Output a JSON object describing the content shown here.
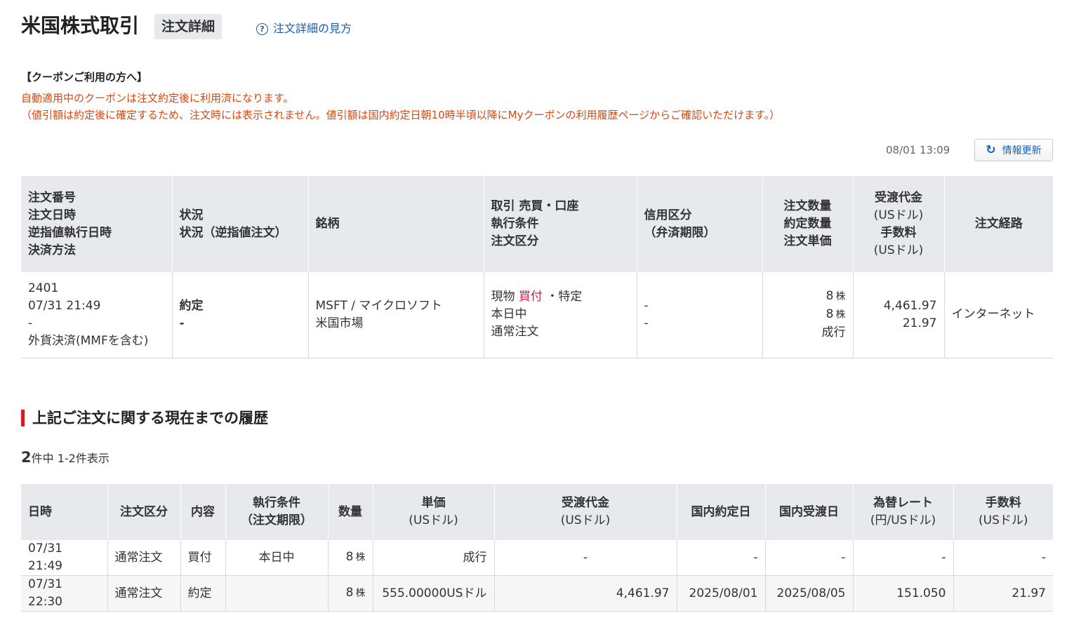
{
  "header": {
    "title": "米国株式取引",
    "badge": "注文詳細",
    "help_icon": "question-circle-icon",
    "help_link": "注文詳細の見方"
  },
  "coupon": {
    "heading": "【クーポンご利用の方へ】",
    "line1": "自動適用中のクーポンは注文約定後に利用済になります。",
    "line2": "（値引額は約定後に確定するため、注文時には表示されません。値引額は国内約定日朝10時半頃以降にMyクーポンの利用履歴ページからご確認いただけます。）"
  },
  "refresh": {
    "timestamp": "08/01 13:09",
    "icon": "refresh-icon",
    "label": "情報更新"
  },
  "order_table": {
    "headers": {
      "c1": [
        "注文番号",
        "注文日時",
        "逆指値執行日時",
        "決済方法"
      ],
      "c2": [
        "状況",
        "状況（逆指値注文）"
      ],
      "c3": [
        "銘柄"
      ],
      "c4": [
        "取引 売買・口座",
        "執行条件",
        "注文区分"
      ],
      "c5": [
        "信用区分",
        "（弁済期限）"
      ],
      "c6": [
        "注文数量",
        "約定数量",
        "注文単価"
      ],
      "c7": {
        "top": "受渡代金",
        "top_sub": "(USドル)",
        "bottom": "手数料",
        "bottom_sub": "(USドル)"
      },
      "c8": "注文経路"
    },
    "row": {
      "order_no": "2401",
      "order_datetime": "07/31 21:49",
      "stop_datetime": "-",
      "settlement": "外貨決済(MMFを含む)",
      "status": "約定",
      "status_stop": "-",
      "symbol": "MSFT / マイクロソフト",
      "market": "米国市場",
      "trade_type": "現物",
      "side": "買付",
      "account": "・特定",
      "condition": "本日中",
      "order_type": "通常注文",
      "margin": "-",
      "margin_due": "-",
      "qty": "8",
      "qty_unit": "株",
      "exec_qty": "8",
      "exec_qty_unit": "株",
      "price": "成行",
      "amount": "4,461.97",
      "fee": "21.97",
      "route": "インターネット"
    }
  },
  "history": {
    "heading": "上記ご注文に関する現在までの履歴",
    "total": "2",
    "count_text": "件中 1-2件表示",
    "headers": {
      "date": "日時",
      "order_type": "注文区分",
      "content": "内容",
      "condition": "執行条件",
      "condition_sub": "（注文期限）",
      "qty": "数量",
      "price": "単価",
      "price_sub": "(USドル)",
      "amount": "受渡代金",
      "amount_sub": "(USドル)",
      "domestic_exec": "国内約定日",
      "domestic_settle": "国内受渡日",
      "fx": "為替レート",
      "fx_sub": "(円/USドル)",
      "fee": "手数料",
      "fee_sub": "(USドル)"
    },
    "rows": [
      {
        "date": "07/31 21:49",
        "order_type": "通常注文",
        "content": "買付",
        "condition": "本日中",
        "qty": "8",
        "unit": "株",
        "price": "成行",
        "amount": "-",
        "domestic_exec": "-",
        "domestic_settle": "-",
        "fx": "-",
        "fee": "-"
      },
      {
        "date": "07/31 22:30",
        "order_type": "通常注文",
        "content": "約定",
        "condition": "",
        "qty": "8",
        "unit": "株",
        "price": "555.00000USドル",
        "amount": "4,461.97",
        "domestic_exec": "2025/08/01",
        "domestic_settle": "2025/08/05",
        "fx": "151.050",
        "fee": "21.97"
      }
    ]
  }
}
